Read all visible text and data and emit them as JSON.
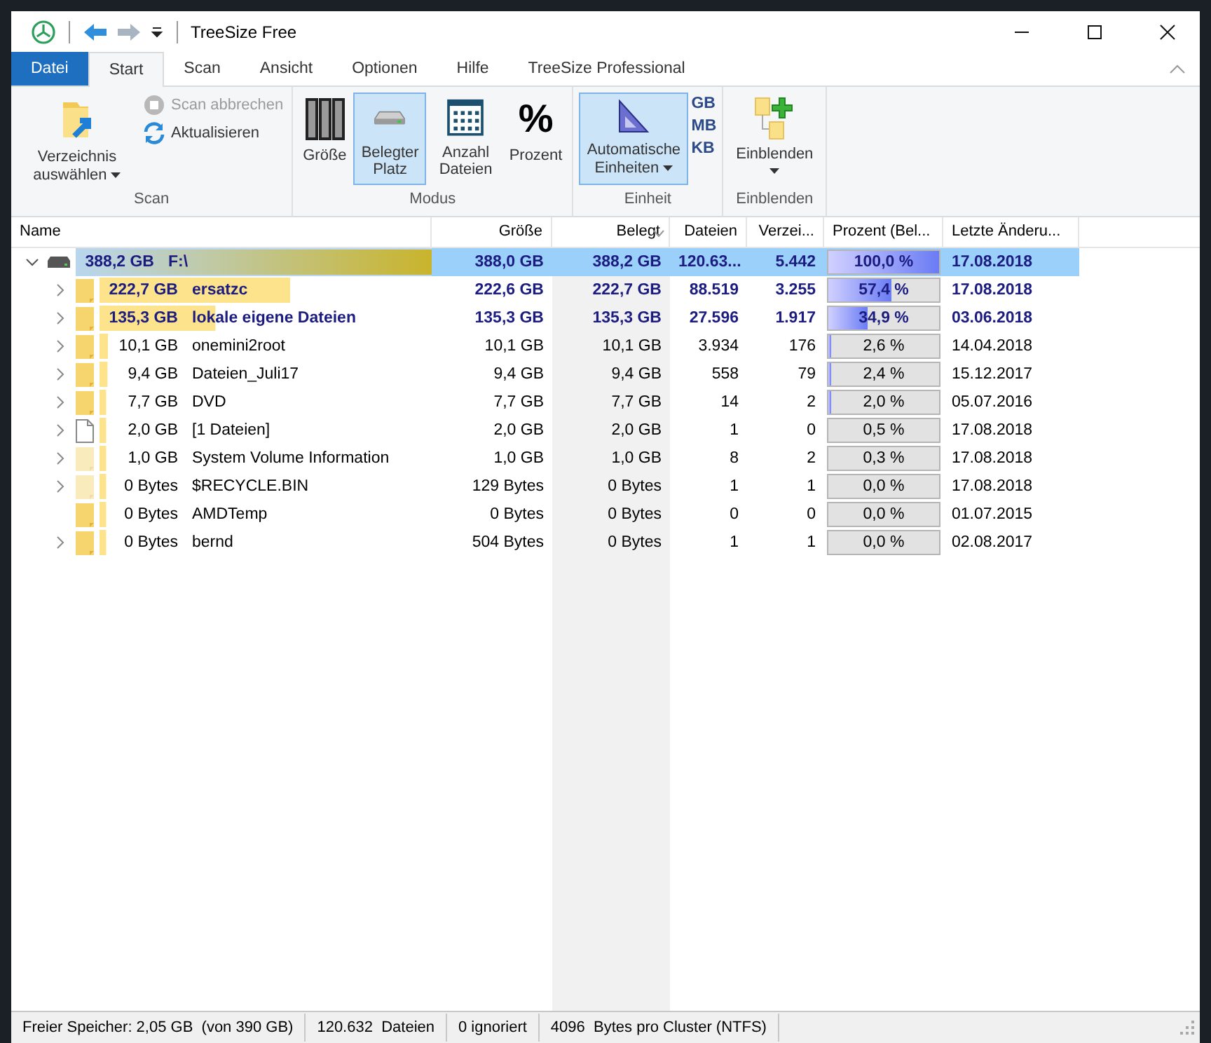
{
  "window": {
    "title": "TreeSize Free"
  },
  "ribbon_tabs": [
    {
      "label": "Datei",
      "kind": "file",
      "selected": false
    },
    {
      "label": "Start",
      "kind": "tab",
      "selected": true
    },
    {
      "label": "Scan",
      "kind": "tab",
      "selected": false
    },
    {
      "label": "Ansicht",
      "kind": "tab",
      "selected": false
    },
    {
      "label": "Optionen",
      "kind": "tab",
      "selected": false
    },
    {
      "label": "Hilfe",
      "kind": "tab",
      "selected": false
    },
    {
      "label": "TreeSize Professional",
      "kind": "tab",
      "selected": false
    }
  ],
  "groups": {
    "scan": {
      "label": "Scan",
      "choose": "Verzeichnis auswählen",
      "cancel": {
        "label": "Scan abbrechen",
        "disabled": true
      },
      "refresh": "Aktualisieren"
    },
    "modus": {
      "label": "Modus",
      "buttons": [
        {
          "label": "Größe",
          "kind": "bars",
          "selected": false
        },
        {
          "label": "Belegter Platz",
          "kind": "drive",
          "selected": true
        },
        {
          "label": "Anzahl Dateien",
          "kind": "grid",
          "selected": false
        },
        {
          "label": "Prozent",
          "kind": "percent",
          "glyph": "%",
          "selected": false
        }
      ]
    },
    "einheit": {
      "label": "Einheit",
      "auto": {
        "label": "Automatische Einheiten",
        "selected": true
      },
      "units": [
        "GB",
        "MB",
        "KB"
      ]
    },
    "einblenden": {
      "label": "Einblenden",
      "button": "Einblenden"
    }
  },
  "table": {
    "columns": [
      "Name",
      "Größe",
      "Belegt",
      "Dateien",
      "Verzei...",
      "Prozent (Bel...",
      "Letzte Änderu..."
    ],
    "rows": [
      {
        "kind": "drive",
        "expanded": true,
        "has_children": true,
        "selected": true,
        "bold": true,
        "size_label": "388,2 GB",
        "name": "F:\\",
        "groesse": "388,0 GB",
        "belegt": "388,2 GB",
        "dateien": "120.63...",
        "verz": "5.442",
        "level": 1.0,
        "prozent": "100,0 %",
        "datum": "17.08.2018",
        "children": [
          {
            "kind": "folder",
            "has_children": true,
            "selected": false,
            "bold": true,
            "size_label": "222,7 GB",
            "name": "ersatzc",
            "groesse": "222,6 GB",
            "belegt": "222,7 GB",
            "dateien": "88.519",
            "verz": "3.255",
            "level": 0.574,
            "prozent": "57,4 %",
            "datum": "17.08.2018"
          },
          {
            "kind": "folder",
            "has_children": true,
            "selected": false,
            "bold": true,
            "size_label": "135,3 GB",
            "name": "lokale eigene Dateien",
            "groesse": "135,3 GB",
            "belegt": "135,3 GB",
            "dateien": "27.596",
            "verz": "1.917",
            "level": 0.349,
            "prozent": "34,9 %",
            "datum": "03.06.2018"
          },
          {
            "kind": "folder",
            "has_children": true,
            "selected": false,
            "bold": false,
            "size_label": "10,1 GB",
            "name": "onemini2root",
            "groesse": "10,1 GB",
            "belegt": "10,1 GB",
            "dateien": "3.934",
            "verz": "176",
            "level": 0.026,
            "prozent": "2,6 %",
            "datum": "14.04.2018"
          },
          {
            "kind": "folder",
            "has_children": true,
            "selected": false,
            "bold": false,
            "size_label": "9,4 GB",
            "name": "Dateien_Juli17",
            "groesse": "9,4 GB",
            "belegt": "9,4 GB",
            "dateien": "558",
            "verz": "79",
            "level": 0.024,
            "prozent": "2,4 %",
            "datum": "15.12.2017"
          },
          {
            "kind": "folder",
            "has_children": true,
            "selected": false,
            "bold": false,
            "size_label": "7,7 GB",
            "name": "DVD",
            "groesse": "7,7 GB",
            "belegt": "7,7 GB",
            "dateien": "14",
            "verz": "2",
            "level": 0.02,
            "prozent": "2,0 %",
            "datum": "05.07.2016"
          },
          {
            "kind": "file",
            "has_children": true,
            "selected": false,
            "bold": false,
            "size_label": "2,0 GB",
            "name": "[1 Dateien]",
            "groesse": "2,0 GB",
            "belegt": "2,0 GB",
            "dateien": "1",
            "verz": "0",
            "level": 0.005,
            "prozent": "0,5 %",
            "datum": "17.08.2018"
          },
          {
            "kind": "hidden-folder",
            "has_children": true,
            "selected": false,
            "bold": false,
            "size_label": "1,0 GB",
            "name": "System Volume Information",
            "groesse": "1,0 GB",
            "belegt": "1,0 GB",
            "dateien": "8",
            "verz": "2",
            "level": 0.003,
            "prozent": "0,3 %",
            "datum": "17.08.2018"
          },
          {
            "kind": "hidden-folder",
            "has_children": true,
            "selected": false,
            "bold": false,
            "size_label": "0 Bytes",
            "name": "$RECYCLE.BIN",
            "groesse": "129 Bytes",
            "belegt": "0 Bytes",
            "dateien": "1",
            "verz": "1",
            "level": 0.0,
            "prozent": "0,0 %",
            "datum": "17.08.2018"
          },
          {
            "kind": "folder",
            "has_children": false,
            "selected": false,
            "bold": false,
            "size_label": "0 Bytes",
            "name": "AMDTemp",
            "groesse": "0 Bytes",
            "belegt": "0 Bytes",
            "dateien": "0",
            "verz": "0",
            "level": 0.0,
            "prozent": "0,0 %",
            "datum": "01.07.2015"
          },
          {
            "kind": "folder",
            "has_children": true,
            "selected": false,
            "bold": false,
            "size_label": "0 Bytes",
            "name": "bernd",
            "groesse": "504 Bytes",
            "belegt": "0 Bytes",
            "dateien": "1",
            "verz": "1",
            "level": 0.0,
            "prozent": "0,0 %",
            "datum": "02.08.2017"
          }
        ]
      }
    ]
  },
  "status_bar": [
    "Freier Speicher: 2,05 GB  (von 390 GB)",
    "120.632  Dateien",
    "0 ignoriert",
    "4096  Bytes pro Cluster (NTFS)"
  ]
}
